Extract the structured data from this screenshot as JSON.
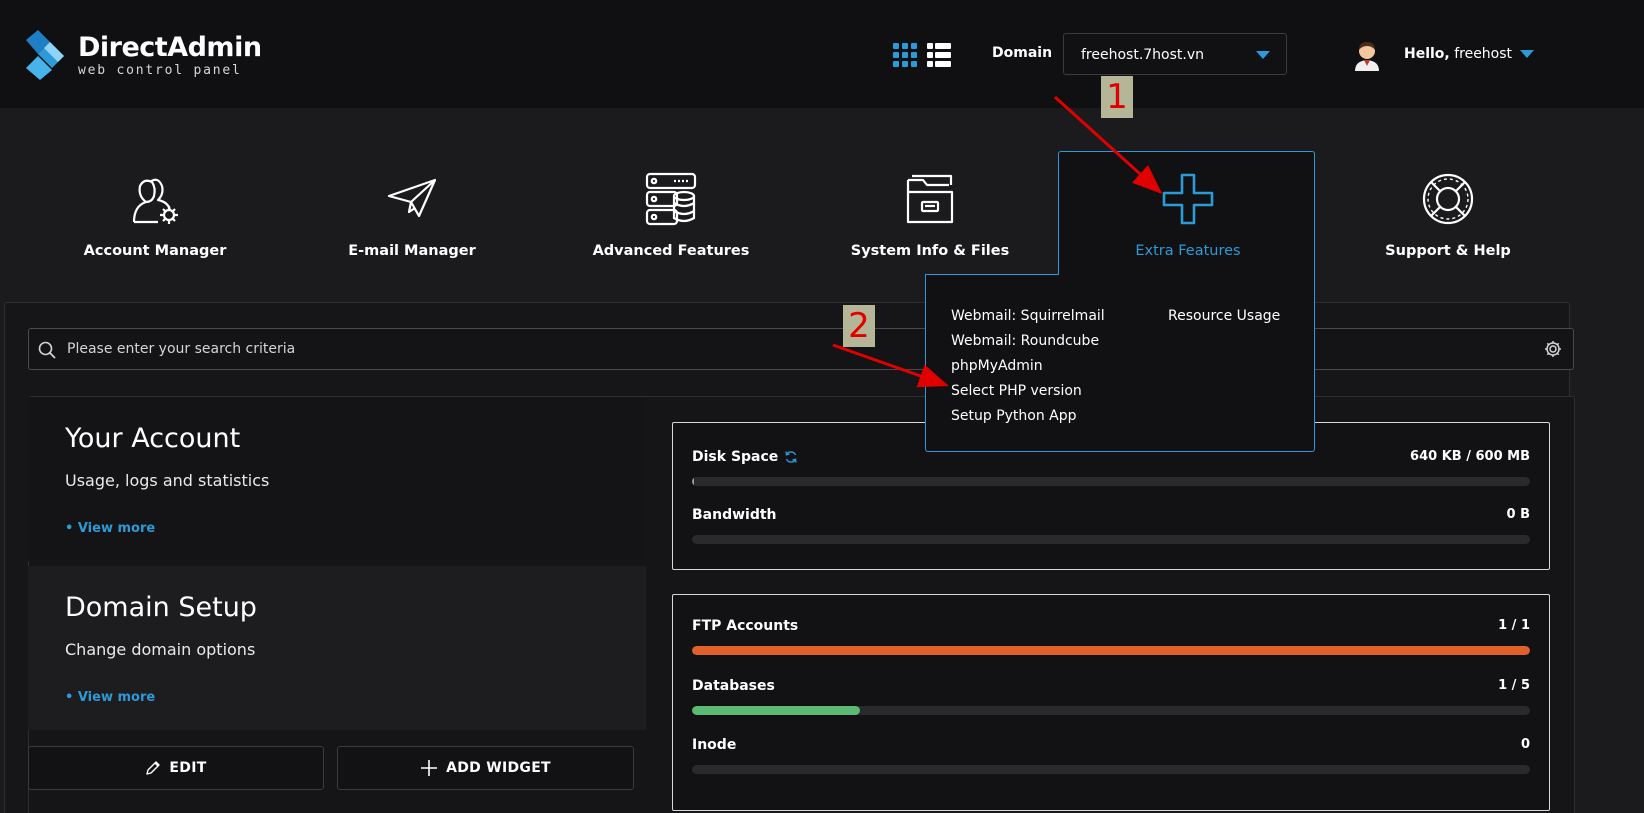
{
  "header": {
    "logo_title": "DirectAdmin",
    "logo_subtitle": "web control panel",
    "domain_label": "Domain",
    "domain_value": "freehost.7host.vn",
    "hello_prefix": "Hello,",
    "username": "freehost"
  },
  "nav": {
    "items": [
      {
        "label": "Account Manager",
        "icon": "users-gear-icon"
      },
      {
        "label": "E-mail Manager",
        "icon": "paper-plane-icon"
      },
      {
        "label": "Advanced Features",
        "icon": "server-database-icon"
      },
      {
        "label": "System Info & Files",
        "icon": "folder-icon"
      },
      {
        "label": "Extra Features",
        "icon": "plus-icon",
        "active": true
      },
      {
        "label": "Support & Help",
        "icon": "lifebuoy-icon"
      }
    ]
  },
  "dropdown": {
    "col1": [
      "Webmail: Squirrelmail",
      "Webmail: Roundcube",
      "phpMyAdmin",
      "Select PHP version",
      "Setup Python App"
    ],
    "col2": [
      "Resource Usage"
    ]
  },
  "search": {
    "placeholder": "Please enter your search criteria"
  },
  "cards": [
    {
      "title": "Your Account",
      "subtitle": "Usage, logs and statistics",
      "link": "• View more"
    },
    {
      "title": "Domain Setup",
      "subtitle": "Change domain options",
      "link": "• View more"
    }
  ],
  "buttons": {
    "edit": "EDIT",
    "add_widget": "ADD WIDGET"
  },
  "stats": {
    "disk_space": {
      "label": "Disk Space",
      "value": "640 KB / 600 MB",
      "fraction": 0.001
    },
    "bandwidth": {
      "label": "Bandwidth",
      "value": "0 B",
      "fraction": 0
    },
    "ftp_accounts": {
      "label": "FTP Accounts",
      "value": "1 / 1",
      "fraction": 1.0,
      "color": "#e0622a"
    },
    "databases": {
      "label": "Databases",
      "value": "1 / 5",
      "fraction": 0.2,
      "color": "#5cba74"
    },
    "inode": {
      "label": "Inode",
      "value": "0",
      "fraction": 0
    }
  },
  "annotations": [
    "1",
    "2"
  ],
  "colors": {
    "accent": "#2c9ad6",
    "header_bg": "#101012",
    "page_bg": "#1b1b1d"
  }
}
